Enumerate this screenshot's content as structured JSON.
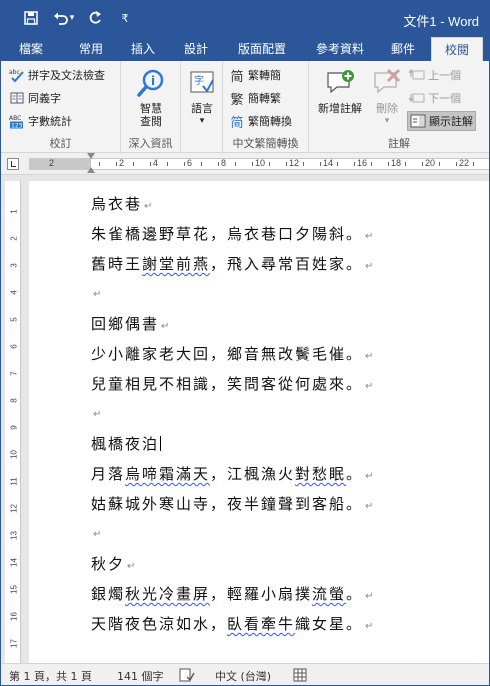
{
  "window": {
    "title": "文件1 - Word"
  },
  "qat": {
    "save_icon": "save-icon",
    "undo_icon": "undo-icon",
    "undo_dropdown": "▾",
    "redo_icon": "redo-icon",
    "customize": "₹"
  },
  "tabs": [
    {
      "label": "檔案"
    },
    {
      "label": "常用"
    },
    {
      "label": "插入"
    },
    {
      "label": "設計"
    },
    {
      "label": "版面配置"
    },
    {
      "label": "參考資料"
    },
    {
      "label": "郵件"
    },
    {
      "label": "校閱"
    }
  ],
  "ribbon": {
    "proofing": {
      "label": "校訂",
      "spelling": "拼字及文法檢查",
      "thesaurus": "同義字",
      "wordcount": "字數統計",
      "abc_badge": "ABC"
    },
    "insights": {
      "label": "深入資訊",
      "smart_lookup_line1": "智慧",
      "smart_lookup_line2": "查閱"
    },
    "language": {
      "label_btn": "語言",
      "dropdown": "▾"
    },
    "chinese": {
      "label": "中文繁簡轉換",
      "to_trad": "繁轉簡",
      "to_simp": "簡轉繁",
      "convert": "繁簡轉換",
      "glyph1": "简",
      "glyph2": "繁",
      "glyph3": "简"
    },
    "comments": {
      "label": "註解",
      "new_comment": "新增註解",
      "delete": "刪除",
      "delete_dropdown": "▾",
      "previous": "上一個",
      "next": "下一個",
      "show": "顯示註解"
    }
  },
  "ruler": {
    "h_numbers": [
      "2",
      "2",
      "4",
      "6",
      "8",
      "10",
      "12",
      "14",
      "16",
      "18",
      "20",
      "22"
    ],
    "v_numbers": [
      "1",
      "2",
      "3",
      "4",
      "5",
      "6",
      "7",
      "8",
      "9",
      "10",
      "11",
      "12",
      "13",
      "14",
      "15",
      "16",
      "17"
    ]
  },
  "document": {
    "para_mark": "↵",
    "lines": [
      {
        "segments": [
          {
            "text": "烏衣巷"
          }
        ],
        "mark": true
      },
      {
        "segments": [
          {
            "text": "朱雀橋邊野草花，烏衣巷口夕陽斜。"
          }
        ],
        "mark": true
      },
      {
        "segments": [
          {
            "text": "舊時王"
          },
          {
            "text": "謝堂前燕",
            "sq": true
          },
          {
            "text": "，飛入尋常百姓家。"
          }
        ],
        "mark": true
      },
      {
        "segments": [
          {
            "text": ""
          }
        ],
        "mark": true
      },
      {
        "segments": [
          {
            "text": "回鄉偶書"
          }
        ],
        "mark": true
      },
      {
        "segments": [
          {
            "text": "少小離家老大回，鄉音無改鬢毛催。"
          }
        ],
        "mark": true
      },
      {
        "segments": [
          {
            "text": "兒童相見不相識，笑問客從何處來。"
          }
        ],
        "mark": true
      },
      {
        "segments": [
          {
            "text": ""
          }
        ],
        "mark": true
      },
      {
        "segments": [
          {
            "text": "楓橋夜泊"
          }
        ],
        "caret": true
      },
      {
        "segments": [
          {
            "text": "月落"
          },
          {
            "text": "烏啼霜滿天",
            "sq": true
          },
          {
            "text": "，江楓漁火"
          },
          {
            "text": "對愁眠",
            "sq": true
          },
          {
            "text": "。"
          }
        ],
        "mark": true
      },
      {
        "segments": [
          {
            "text": "姑蘇城外寒山寺，夜半鐘聲到客船。"
          }
        ],
        "mark": true
      },
      {
        "segments": [
          {
            "text": ""
          }
        ],
        "mark": true
      },
      {
        "segments": [
          {
            "text": "秋夕"
          }
        ],
        "mark": true
      },
      {
        "segments": [
          {
            "text": "銀燭"
          },
          {
            "text": "秋光冷畫屏",
            "sq": true
          },
          {
            "text": "，輕羅小扇撲"
          },
          {
            "text": "流螢",
            "sq": true
          },
          {
            "text": "。"
          }
        ],
        "mark": true
      },
      {
        "segments": [
          {
            "text": "天階夜色涼如水，"
          },
          {
            "text": "臥看牽牛",
            "sq": true
          },
          {
            "text": "織女星。"
          }
        ],
        "mark": true
      }
    ]
  },
  "status": {
    "page": "第 1 頁，共 1 頁",
    "words": "141 個字",
    "language": "中文 (台灣)"
  },
  "colors": {
    "brand": "#2b579a",
    "squiggle": "#3355ff"
  }
}
